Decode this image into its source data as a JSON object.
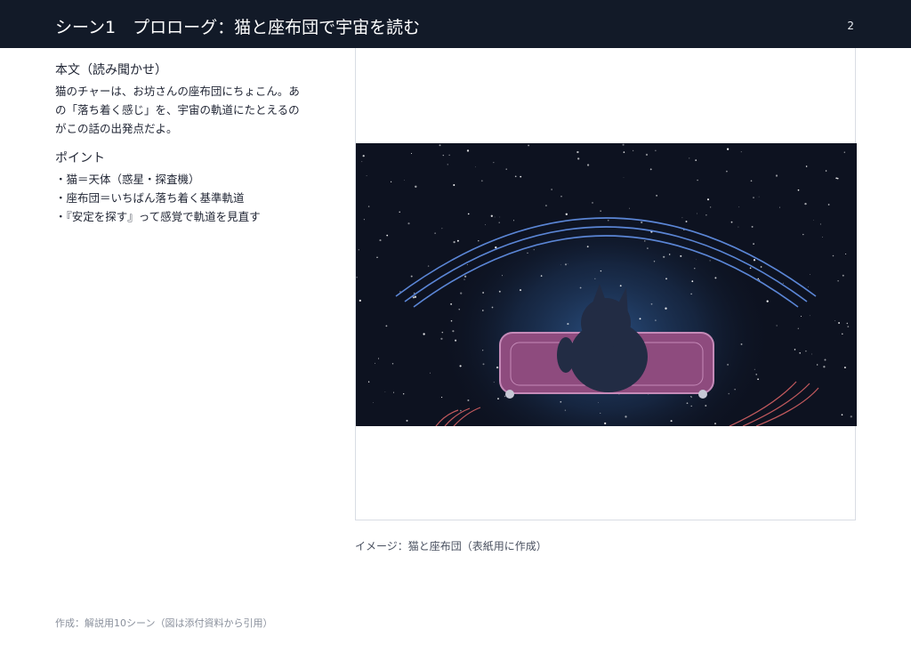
{
  "header": {
    "title": "シーン1　プロローグ：猫と座布団で宇宙を読む",
    "page_number": "2",
    "background": "#121a28"
  },
  "main": {
    "section_title": "本文（読み聞かせ）",
    "body_lines": [
      "猫のチャーは、お坊さんの座布団にちょこん。あ",
      "の「落ち着く感じ」を、宇宙の軌道にたとえるの",
      "がこの話の出発点だよ。"
    ],
    "points_title": "ポイント",
    "points": [
      "・猫＝天体（惑星・探査機）",
      "・座布団＝いちばん落ち着く基準軌道",
      "・『安定を探す』って感覚で軌道を見直す"
    ]
  },
  "figure": {
    "caption": "イメージ：猫と座布団（表紙用に作成）",
    "colors": {
      "space": "#0d1220",
      "glow": "#2a4a7a",
      "orbit": "#5b86d6",
      "cushion": "#8e4b7e",
      "cushion_border": "#c58ab8",
      "cat": "#222c44",
      "red_arcs": "#c45a5e"
    },
    "icons": [
      "cat-silhouette",
      "cushion",
      "orbit-arcs",
      "stars"
    ]
  },
  "footer": {
    "text": "作成：解説用10シーン（図は添付資料から引用）"
  }
}
